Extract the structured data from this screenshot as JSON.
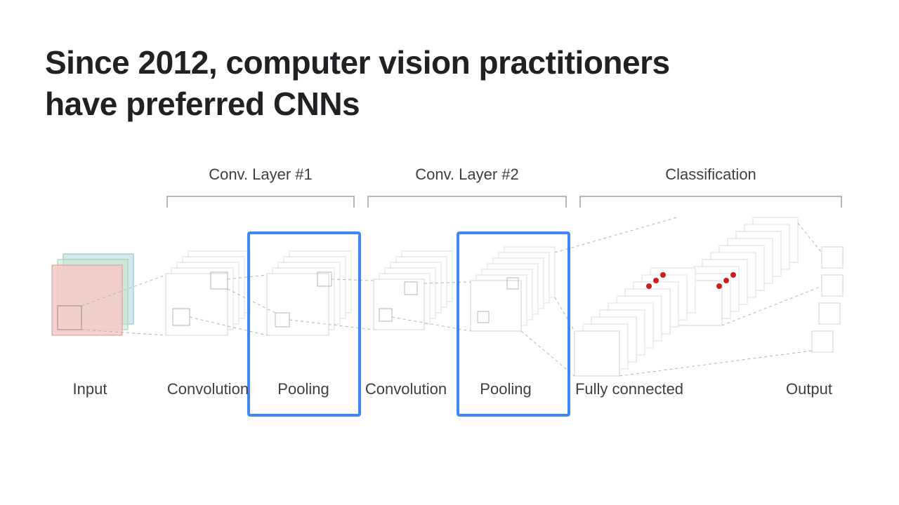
{
  "slide": {
    "title_line1": "Since 2012, computer vision practitioners",
    "title_line2": "have preferred CNNs"
  },
  "sections": {
    "conv1": "Conv. Layer #1",
    "conv2": "Conv. Layer #2",
    "classification": "Classification"
  },
  "stages": {
    "input": "Input",
    "conv_a": "Convolution",
    "pool_a": "Pooling",
    "conv_b": "Convolution",
    "pool_b": "Pooling",
    "fc": "Fully connected",
    "output": "Output"
  },
  "highlight_color": "#4285f4",
  "input_colors": {
    "front": "#f6c9c6",
    "back": "#bfe0e6"
  },
  "dot_color": "#c5221f"
}
